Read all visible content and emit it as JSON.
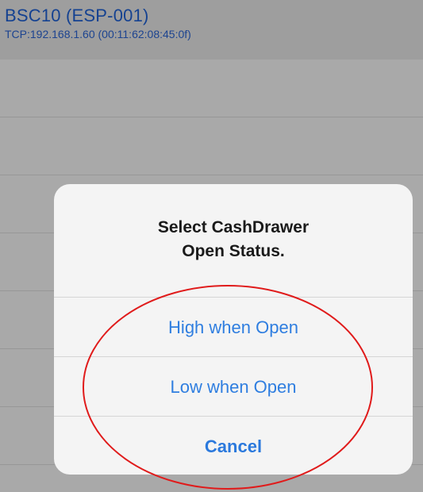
{
  "device": {
    "name": "BSC10 (ESP-001)",
    "address": "TCP:192.168.1.60 (00:11:62:08:45:0f)"
  },
  "alert": {
    "title": "Select CashDrawer\nOpen Status.",
    "actions": [
      {
        "label": "High when Open"
      },
      {
        "label": "Low when Open"
      },
      {
        "label": "Cancel"
      }
    ]
  },
  "colors": {
    "link_blue": "#2f7ee0",
    "header_blue": "#1f5fd0",
    "annotation_red": "#e01b1b"
  }
}
